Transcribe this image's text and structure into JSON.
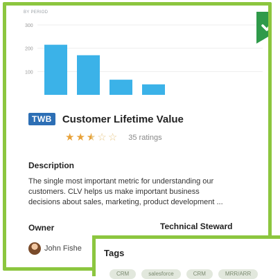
{
  "chart_data": {
    "type": "bar",
    "title": "BY PERIOD",
    "yticks": [
      "300",
      "200",
      "100"
    ],
    "ylim": [
      0,
      300
    ],
    "values": [
      215,
      170,
      65,
      45
    ],
    "color": "#3bb2e8"
  },
  "badge": "TWB",
  "title": "Customer Lifetime Value",
  "rating": {
    "value": 2.5,
    "max": 5,
    "label": "35 ratings"
  },
  "description": {
    "heading": "Description",
    "lines": [
      "The single most important metric for understanding our",
      "customers. CLV helps us make important business",
      "decisions about sales, marketing, product development ..."
    ]
  },
  "owner": {
    "heading": "Owner",
    "name": "John Fishe"
  },
  "steward": {
    "heading": "Technical Steward"
  },
  "tags": {
    "heading": "Tags",
    "items": [
      "CRM",
      "salesforce",
      "CRM",
      "MRR/ARR"
    ]
  },
  "colors": {
    "accent": "#8cc63f",
    "badge": "#2d6fb5",
    "star": "#e8a23a",
    "bar": "#3bb2e8"
  },
  "icons": {
    "ribbon": "check-icon"
  }
}
